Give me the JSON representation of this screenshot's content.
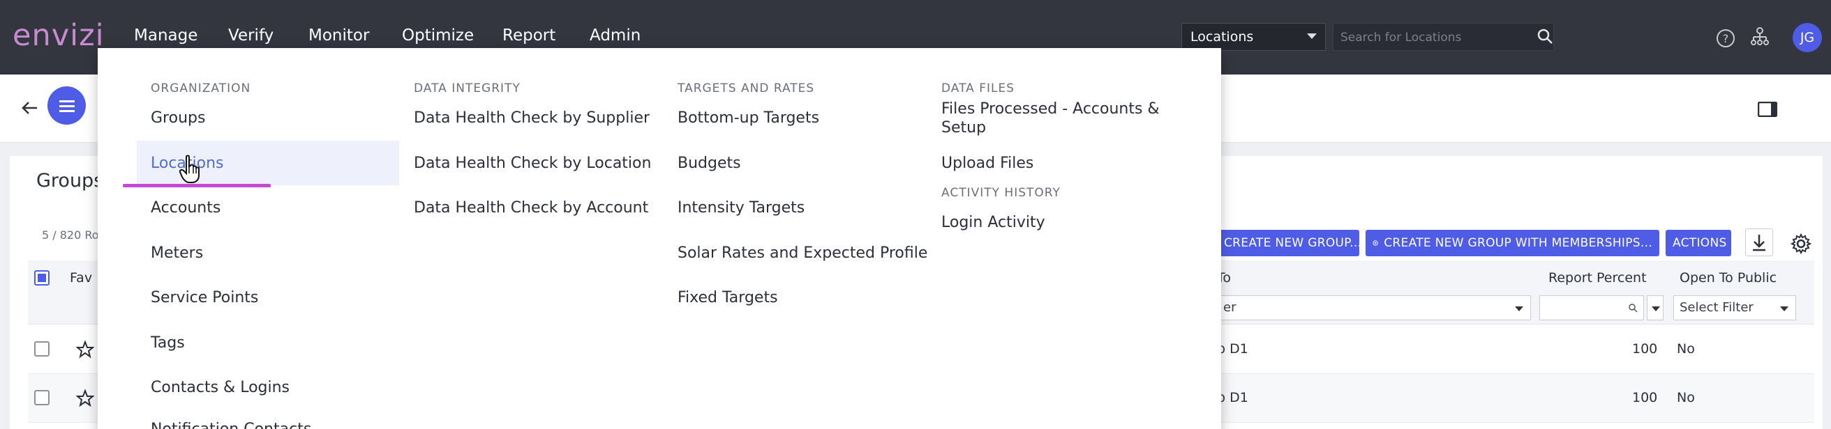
{
  "app": {
    "logo": "envizi"
  },
  "topnav": {
    "items": [
      "Manage",
      "Verify",
      "Monitor",
      "Optimize",
      "Report",
      "Admin"
    ],
    "location_select": "Locations",
    "search_placeholder": "Search for Locations",
    "user_initials": "JG",
    "accent_color": "#c44bd6",
    "primary_color": "#4f5de6"
  },
  "page": {
    "title": "Groups",
    "rows_count": "5 / 820 Ro",
    "buttons": {
      "create_group": "CREATE NEW GROUP...",
      "create_with_memberships": "CREATE NEW GROUP WITH MEMBERSHIPS...",
      "actions": "ACTIONS"
    },
    "columns": {
      "fav": "Fav",
      "rolls_to": "To",
      "report_percent": "Report Percent",
      "open_to_public": "Open To Public"
    },
    "filters": {
      "rolls_to": "er",
      "open_to_public": "Select Filter"
    },
    "rows": [
      {
        "rolls_to": "p D1",
        "report_percent": "100",
        "open_to_public": "No"
      },
      {
        "rolls_to": "p D1",
        "report_percent": "100",
        "open_to_public": "No"
      }
    ]
  },
  "mega_menu": {
    "organization": {
      "heading": "ORGANIZATION",
      "items": [
        "Groups",
        "Locations",
        "Accounts",
        "Meters",
        "Service Points",
        "Tags",
        "Contacts & Logins",
        "Notification Contacts"
      ]
    },
    "data_integrity": {
      "heading": "DATA INTEGRITY",
      "items": [
        "Data Health Check by Supplier",
        "Data Health Check by Location",
        "Data Health Check by Account"
      ]
    },
    "targets_rates": {
      "heading": "TARGETS AND RATES",
      "items": [
        "Bottom-up Targets",
        "Budgets",
        "Intensity Targets",
        "Solar Rates and Expected Profile",
        "Fixed Targets"
      ]
    },
    "data_files": {
      "heading": "DATA FILES",
      "items": [
        "Files Processed - Accounts &",
        "Setup",
        "Upload Files"
      ]
    },
    "activity_history": {
      "heading": "ACTIVITY HISTORY",
      "items": [
        "Login Activity"
      ]
    }
  }
}
